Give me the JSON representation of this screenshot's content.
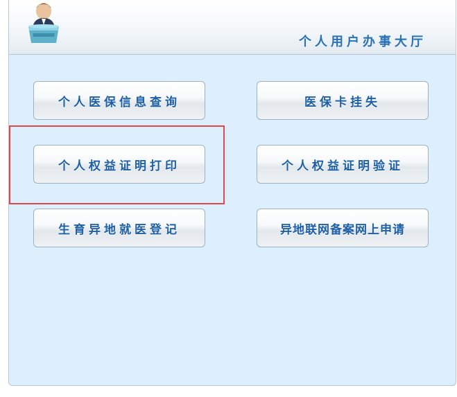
{
  "header": {
    "title": "个人用户办事大厅"
  },
  "buttons": {
    "personal_insurance_query": "个人医保信息查询",
    "card_report_loss": "医保卡挂失",
    "rights_certificate_print": "个人权益证明打印",
    "rights_certificate_verify": "个人权益证明验证",
    "maternity_remote_registration": "生育异地就医登记",
    "remote_network_filing": "异地联网备案网上申请"
  },
  "colors": {
    "accent_text": "#1e5fa6",
    "panel_background": "#ddeefc",
    "highlight_border": "#e0484c"
  },
  "icons": {
    "header_avatar": "service-clerk-avatar-icon"
  }
}
